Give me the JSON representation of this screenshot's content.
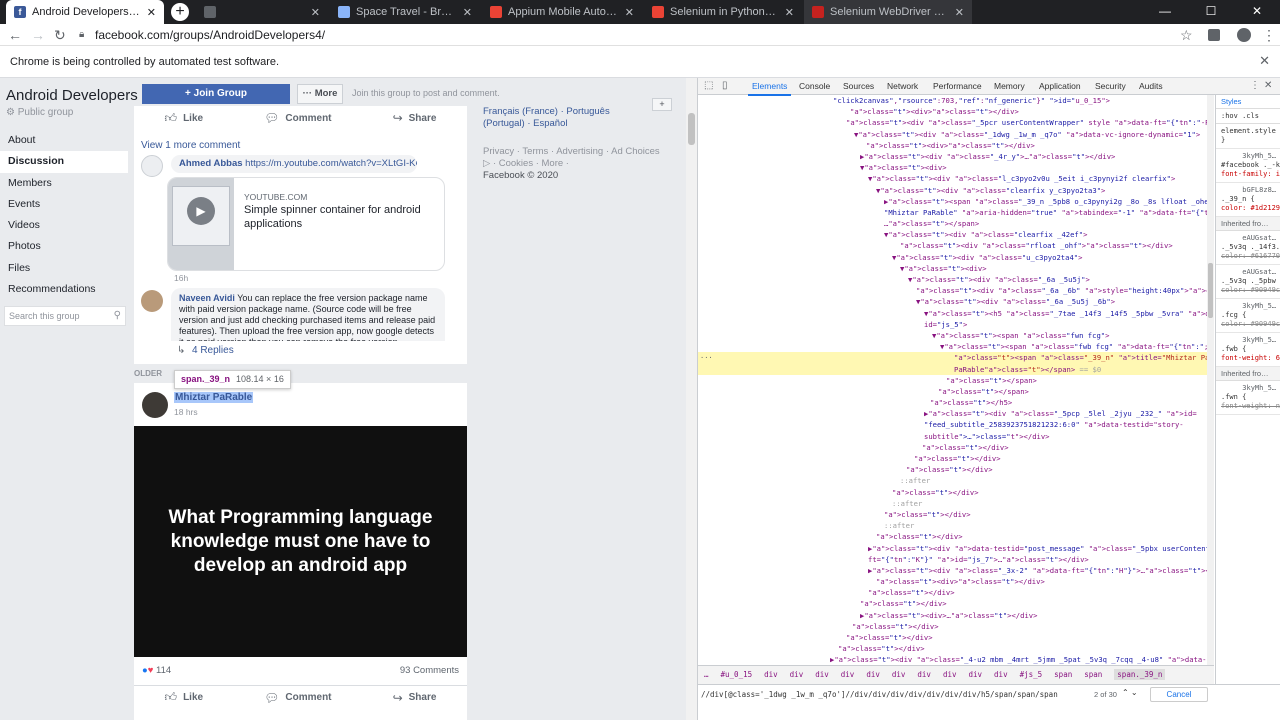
{
  "browser": {
    "tabs": [
      {
        "title": "Android Developers Public Group",
        "active": true,
        "color": "#3b5998"
      },
      {
        "title": "",
        "active": false,
        "color": "#5f6368"
      },
      {
        "title": "Space Travel - Browse articles",
        "active": false,
        "color": "#8ab4f8"
      },
      {
        "title": "Appium Mobile Automation Te",
        "active": false,
        "color": "#ea4335"
      },
      {
        "title": "Selenium in Python Mac-drivers",
        "active": false,
        "color": "#ea4335"
      },
      {
        "title": "Selenium WebDriver With Pyth",
        "active": false,
        "color": "#c5221f"
      }
    ],
    "new_tab": "+",
    "window_controls": [
      "—",
      "☐",
      "✕"
    ],
    "url": "facebook.com/groups/AndroidDevelopers4/",
    "automation_notice": "Chrome is being controlled by automated test software."
  },
  "group": {
    "name": "Android Developers",
    "privacy": "Public group",
    "nav": [
      "About",
      "Discussion",
      "Members",
      "Events",
      "Videos",
      "Photos",
      "Files",
      "Recommendations"
    ],
    "active_nav": "Discussion",
    "search_placeholder": "Search this group",
    "join_label": "+ Join Group",
    "more_label": "··· More",
    "join_hint": "Join this group to post and comment."
  },
  "post1": {
    "actions": {
      "like": "Like",
      "comment": "Comment",
      "share": "Share"
    },
    "view_more": "View 1 more comment",
    "comment1": {
      "author": "Ahmed Abbas",
      "link": "https://m.youtube.com/watch?v=XLtGI-KCWhc",
      "age": "16h"
    },
    "preview": {
      "source": "YOUTUBE.COM",
      "title": "Simple spinner container for android applications"
    },
    "comment2": {
      "author": "Naveen Avidi",
      "text": "You can replace the free version package name with paid version package name. (Source code will be free version and just add checking purchased items and release paid features). Then upload the free version app, now google detects it as paid version then you can remove the free version.",
      "age": "31m"
    },
    "replies": "4 Replies"
  },
  "older_label": "OLDER",
  "tooltip": {
    "selector": "span._39_n",
    "size": "108.14 × 16"
  },
  "post2": {
    "author": "Mhiztar PaRable",
    "age": "18 hrs",
    "image_text": "What Programming language knowledge must one have to develop an android app",
    "reactions_count": "114",
    "comments_count": "93 Comments",
    "actions": {
      "like": "Like",
      "comment": "Comment",
      "share": "Share"
    }
  },
  "right_column": {
    "languages": "Français (France) · Português (Portugal) · Español",
    "add": "+",
    "footer_links": "Privacy · Terms · Advertising · Ad Choices ▷ · Cookies · More ·",
    "copyright": "Facebook © 2020"
  },
  "devtools": {
    "tabs": [
      "Elements",
      "Console",
      "Sources",
      "Network",
      "Performance",
      "Memory",
      "Application",
      "Security",
      "Audits"
    ],
    "active_tab": "Elements",
    "dom_lines": [
      "\"click2canvas\",\"rsource\":703,\"ref\":\"nf_generic\"}\" id=\"u_0_15\">",
      "<div></div>",
      "<div class=\"_5pcr userContentWrapper\" style data-ft=\"{\"tn\":\"-R\"}\">",
      "▼<div class=\"_1dwg _1w_m _q7o\" data-vc-ignore-dynamic=\"1\">",
      "<div></div>",
      "▶<div class=\"_4r_y\">…</div>",
      "▼<div>",
      "▼<div class=\"l_c3pyo2v0u _5eit i_c3pynyi2f clearfix\">",
      "▼<div class=\"clearfix y_c3pyo2ta3\">",
      "▶<span class=\"_39_n _5pb8 o_c3pynyi2g _8o _8s lfloat _ohe\" title=",
      "\"Mhiztar PaRable\" aria-hidden=\"true\" tabindex=\"-1\" data-ft=\"{\"tn\":\"m\"}\">",
      "…</span>",
      "▼<div class=\"clearfix _42ef\">",
      "<div class=\"rfloat _ohf\"></div>",
      "▼<div class=\"u_c3pyo2ta4\">",
      "▼<div>",
      "▼<div class=\"_6a _5u5j\">",
      "<div class=\"_6a _6b\" style=\"height:40px\"></div>",
      "▼<div class=\"_6a _5u5j _6b\">",
      "▼<h5 class=\"_7tae _14f3 _14f5 _5pbw _5vra\" data-ft=\"{\"tn\":\"C\"}\"",
      "id=\"js_5\">",
      "▼<span class=\"fwn fcg\">",
      "▼<span class=\"fwb fcg\" data-ft=\"{\"tn\":\";\"}\">",
      "<span class=\"_39_n\" title=\"Mhiztar PaRable\">Mhiztar",
      "PaRable</span> == $0",
      "</span>",
      "</span>",
      "</h5>",
      "▶<div class=\"_5pcp _5lel _2jyu _232_\" id=",
      "\"feed_subtitle_2583923751821232:6:0\" data-testid=\"story-",
      "subtitle\">…</div>",
      "</div>",
      "</div>",
      "</div>",
      "::after",
      "</div>",
      "::after",
      "</div>",
      "::after",
      "</div>",
      "▶<div data-testid=\"post_message\" class=\"_5pbx userContent _3577\" data-",
      "ft=\"{\"tn\":\"K\"}\" id=\"js_7\">…</div>",
      "▶<div class=\"_3x-2\" data-ft=\"{\"tn\":\"H\"}\">…</div>",
      "<div></div>",
      "</div>",
      "</div>",
      "▶<div>…</div>",
      "</div>",
      "</div>",
      "</div>",
      "▶<div class=\"_4-u2 mbm _4mrt _5jmm _5pat _5v3q _7cqq _4-u8\" data-fte=\"1\" data-ftr=",
      "\"1\" id=\"mall_post_2583933085153632:6:0\" role=\"article\" aria-labelledby=\"js_8\" aria-"
    ],
    "styles": {
      "tab": "Styles",
      "filter": ":hov .cls",
      "element_style": "element.style {",
      "rules": [
        {
          "source": "3kyMh_5…",
          "selector": "#facebook ._-kb span {",
          "decl": "font-family: inherit"
        },
        {
          "source": "bGFL8z8…",
          "selector": "._39_n {",
          "decl": "color: #1d2129"
        },
        {
          "source": "eAUGsat…",
          "selector": "._5v3q ._14f3._5pbw .fcg, ._5v3q ._14f3._1qbu._5pbw .fcg {",
          "decl": "color: #616770"
        },
        {
          "source": "eAUGsat…",
          "selector": "._5v3q ._5pbw .fcg {",
          "decl": "color: #90949c"
        },
        {
          "source": "3kyMh_5…",
          "selector": ".fcg {",
          "decl": "color: #90949c"
        },
        {
          "source": "3kyMh_5…",
          "selector": ".fwb {",
          "decl": "font-weight: 600;"
        }
      ],
      "inherited1": "Inherited fro…",
      "inherited2": "Inherited fro…",
      "last_rule": {
        "source": "3kyMh_5…",
        "selector": ".fwn {",
        "decl": "font-weight: normal"
      }
    },
    "breadcrumbs": [
      "…",
      "#u_0_15",
      "div",
      "div",
      "div",
      "div",
      "div",
      "div",
      "div",
      "div",
      "div",
      "div",
      "#js_5",
      "span",
      "span",
      "span._39_n"
    ],
    "find_query": "//div[@class='_1dwg _1w_m _q7o']//div/div/div/div/div/div/div/h5/span/span/span",
    "find_count": "2 of 30",
    "find_nav": "⌃ ⌄",
    "cancel": "Cancel"
  }
}
